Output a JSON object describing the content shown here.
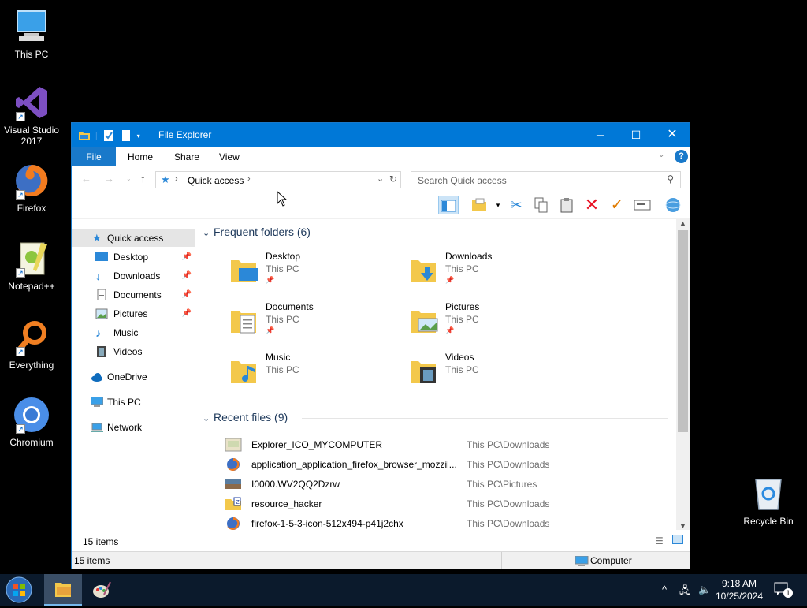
{
  "desktop": {
    "icons": [
      {
        "label": "This PC",
        "icon": "this-pc-icon"
      },
      {
        "label": "Visual Studio 2017",
        "icon": "visual-studio-icon"
      },
      {
        "label": "Firefox",
        "icon": "firefox-icon"
      },
      {
        "label": "Notepad++",
        "icon": "notepadpp-icon"
      },
      {
        "label": "Everything",
        "icon": "everything-icon"
      },
      {
        "label": "Chromium",
        "icon": "chromium-icon"
      },
      {
        "label": "Recycle Bin",
        "icon": "recycle-bin-icon"
      }
    ]
  },
  "window": {
    "title": "File Explorer",
    "ribbon_tabs": [
      "File",
      "Home",
      "Share",
      "View"
    ],
    "address": {
      "location": "Quick access"
    },
    "search": {
      "placeholder": "Search Quick access"
    },
    "nav": [
      {
        "label": "Quick access",
        "icon": "star-icon",
        "pinned": false
      },
      {
        "label": "Desktop",
        "icon": "desktop-icon",
        "pinned": true
      },
      {
        "label": "Downloads",
        "icon": "download-arrow-icon",
        "pinned": true
      },
      {
        "label": "Documents",
        "icon": "document-icon",
        "pinned": true
      },
      {
        "label": "Pictures",
        "icon": "picture-icon",
        "pinned": true
      },
      {
        "label": "Music",
        "icon": "music-note-icon",
        "pinned": false
      },
      {
        "label": "Videos",
        "icon": "film-icon",
        "pinned": false
      },
      {
        "label": "OneDrive",
        "icon": "cloud-icon",
        "pinned": false
      },
      {
        "label": "This PC",
        "icon": "computer-icon",
        "pinned": false
      },
      {
        "label": "Network",
        "icon": "network-icon",
        "pinned": false
      }
    ],
    "frequent": {
      "title": "Frequent folders (6)",
      "folders": [
        {
          "name": "Desktop",
          "location": "This PC",
          "pinned": true
        },
        {
          "name": "Downloads",
          "location": "This PC",
          "pinned": true
        },
        {
          "name": "Documents",
          "location": "This PC",
          "pinned": true
        },
        {
          "name": "Pictures",
          "location": "This PC",
          "pinned": true
        },
        {
          "name": "Music",
          "location": "This PC",
          "pinned": false
        },
        {
          "name": "Videos",
          "location": "This PC",
          "pinned": false
        }
      ]
    },
    "recent": {
      "title": "Recent files (9)",
      "files": [
        {
          "name": "Explorer_ICO_MYCOMPUTER",
          "location": "This PC\\Downloads"
        },
        {
          "name": "application_application_firefox_browser_mozzil...",
          "location": "This PC\\Downloads"
        },
        {
          "name": "I0000.WV2QQ2Dzrw",
          "location": "This PC\\Pictures"
        },
        {
          "name": "resource_hacker",
          "location": "This PC\\Downloads"
        },
        {
          "name": "firefox-1-5-3-icon-512x494-p41j2chx",
          "location": "This PC\\Downloads"
        }
      ]
    },
    "status_inner": "15 items",
    "status_outer": {
      "items": "15 items",
      "location": "Computer"
    }
  },
  "taskbar": {
    "time": "9:18 AM",
    "date": "10/25/2024",
    "notification_count": "1"
  }
}
